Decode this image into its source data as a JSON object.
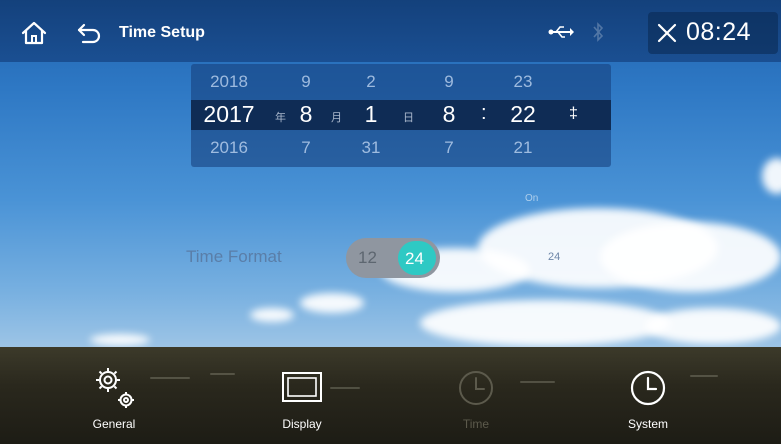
{
  "header": {
    "title": "Time Setup",
    "clock": "08:24",
    "icons": [
      "home-icon",
      "back-icon",
      "usb-icon",
      "bluetooth-icon",
      "close-icon"
    ]
  },
  "date_picker": {
    "prev_row": {
      "year": "2018",
      "month": "9",
      "day": "2",
      "hour": "9",
      "minute": "23"
    },
    "current_row": {
      "year": "2017",
      "year_unit": "年",
      "month": "8",
      "month_unit": "月",
      "day": "1",
      "day_unit": "日",
      "hour": "8",
      "separator": ":",
      "minute": "22",
      "spin_symbol": "‡"
    },
    "next_row": {
      "year": "2016",
      "month": "7",
      "day": "31",
      "hour": "7",
      "minute": "21"
    }
  },
  "time_format": {
    "label": "Time Format",
    "option_12": "12",
    "option_24": "24",
    "selected": "24",
    "value_display": "24",
    "faint_text": "On"
  },
  "bottom_nav": [
    {
      "label": "General",
      "icon": "gears-icon",
      "active": true
    },
    {
      "label": "Display",
      "icon": "display-icon",
      "active": true
    },
    {
      "label": "Time",
      "icon": "clock-icon",
      "active": false
    },
    {
      "label": "System",
      "icon": "clock-icon",
      "active": true
    }
  ],
  "colors": {
    "topbar": "#1a4f92",
    "toggle_accent": "#2ec9c4",
    "picker_selected_row": "#0f2c55"
  }
}
